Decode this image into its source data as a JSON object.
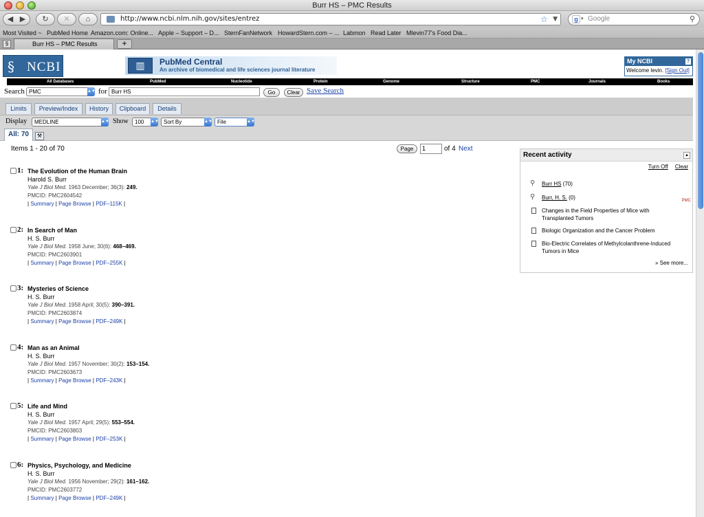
{
  "browser": {
    "window_title": "Burr HS – PMC Results",
    "url": "http://www.ncbi.nlm.nih.gov/sites/entrez",
    "search_placeholder": "Google",
    "tab_title": "Burr HS – PMC Results",
    "new_tab": "+",
    "bookmarks": [
      "Most Visited ~",
      "PubMed Home",
      "Amazon.com: Online...",
      "Apple – Support – D...",
      "SternFanNetwork",
      "HowardStern.com – ...",
      "Labmon",
      "Read Later",
      "Mlevin77's Food Dia..."
    ]
  },
  "header": {
    "ncbi_logo": "NCBI",
    "pmc_title": "PubMed Central",
    "pmc_subtitle": "An archive of biomedical and life sciences journal literature",
    "myncbi_title": "My NCBI",
    "myncbi_help": "?",
    "welcome_prefix": "Welcome levin.",
    "sign_out": "[Sign Out]"
  },
  "databases": [
    "All Databases",
    "PubMed",
    "Nucleotide",
    "Protein",
    "Genome",
    "Structure",
    "PMC",
    "Journals",
    "Books"
  ],
  "search": {
    "label": "Search",
    "database": "PMC",
    "for_label": "for",
    "query": "Burr HS",
    "go": "Go",
    "clear": "Clear",
    "save": "Save Search"
  },
  "tabs": [
    "Limits",
    "Preview/Index",
    "History",
    "Clipboard",
    "Details"
  ],
  "display": {
    "label": "Display",
    "format": "MEDLINE",
    "show_label": "Show",
    "show": "100",
    "sort": "Sort By",
    "send": "File"
  },
  "all_tab": "All: 70",
  "items": "Items 1 - 20 of 70",
  "pager": {
    "button": "Page",
    "page": "1",
    "of": "of 4",
    "next": "Next"
  },
  "results": [
    {
      "num": "1:",
      "title": "The Evolution of the Human Brain",
      "author": "Harold S. Burr",
      "journal": "Yale J Biol Med.",
      "date": "1963 December; 36(3):",
      "pages": "249.",
      "pmcid": "PMCID: PMC2604542",
      "pdf": "PDF–115K"
    },
    {
      "num": "2:",
      "title": "In Search of Man",
      "author": "H. S. Burr",
      "journal": "Yale J Biol Med.",
      "date": "1958 June; 30(6):",
      "pages": "468–469.",
      "pmcid": "PMCID: PMC2603901",
      "pdf": "PDF–255K"
    },
    {
      "num": "3:",
      "title": "Mysteries of Science",
      "author": "H. S. Burr",
      "journal": "Yale J Biol Med.",
      "date": "1958 April; 30(5):",
      "pages": "390–391.",
      "pmcid": "PMCID: PMC2603874",
      "pdf": "PDF–249K"
    },
    {
      "num": "4:",
      "title": "Man as an Animal",
      "author": "H. S. Burr",
      "journal": "Yale J Biol Med.",
      "date": "1957 November; 30(2):",
      "pages": "153–154.",
      "pmcid": "PMCID: PMC2603673",
      "pdf": "PDF–243K"
    },
    {
      "num": "5:",
      "title": "Life and Mind",
      "author": "H. S. Burr",
      "journal": "Yale J Biol Med.",
      "date": "1957 April; 29(5):",
      "pages": "553–554.",
      "pmcid": "PMCID: PMC2603803",
      "pdf": "PDF–253K"
    },
    {
      "num": "6:",
      "title": "Physics, Psychology, and Medicine",
      "author": "H. S. Burr",
      "journal": "Yale J Biol Med.",
      "date": "1956 November; 29(2):",
      "pages": "161–162.",
      "pmcid": "PMCID: PMC2603772",
      "pdf": "PDF–249K"
    }
  ],
  "result_links": {
    "summary": "Summary",
    "page_browse": "Page Browse"
  },
  "recent": {
    "title": "Recent activity",
    "turn_off": "Turn Off",
    "clear": "Clear",
    "items": [
      {
        "icon": "search-icon",
        "text": "Burr HS",
        "suffix": " (70)",
        "tag": ""
      },
      {
        "icon": "search-icon",
        "text": "Burr, H. S.",
        "suffix": " (0)",
        "tag": "PMC"
      },
      {
        "icon": "document-icon",
        "text": "Changes in the Field Properties of Mice with Transplanted Tumors",
        "suffix": "",
        "tag": ""
      },
      {
        "icon": "document-icon",
        "text": "Biologic Organization and the Cancer Problem",
        "suffix": "",
        "tag": ""
      },
      {
        "icon": "document-icon",
        "text": "Bio-Electric Correlates of Methylcolanthrene-Induced Tumors in Mice",
        "suffix": "",
        "tag": ""
      }
    ],
    "see_more": "» See more..."
  }
}
